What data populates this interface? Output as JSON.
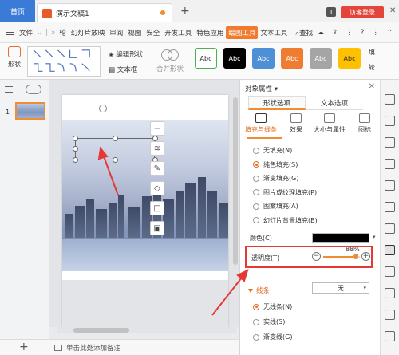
{
  "titlebar": {
    "home_tab": "首页",
    "doc_tab": "演示文稿1",
    "add_tab": "+",
    "badge": "1",
    "login": "访客登录",
    "close": "✕"
  },
  "menubar": {
    "file": "文件",
    "items": [
      "轮",
      "幻灯片放映",
      "审阅",
      "视图",
      "安全",
      "开发工具",
      "特色应用"
    ],
    "active": "绘图工具",
    "text_tool": "文本工具",
    "search": "查找",
    "right_icons": [
      "cloud-icon",
      "share-icon",
      "help-icon",
      "more-icon",
      "collapse-icon"
    ]
  },
  "ribbon": {
    "shape_label": "形状",
    "edit_shape": "编辑形状",
    "text_box": "文本框",
    "merge_shape": "合并形状",
    "style_label": "Abc",
    "styles": [
      {
        "bg": "#ffffff",
        "fg": "#333333",
        "border": "#4caf50"
      },
      {
        "bg": "#000000",
        "fg": "#ffffff",
        "border": "#000000"
      },
      {
        "bg": "#4f8fd6",
        "fg": "#ffffff",
        "border": "#4f8fd6"
      },
      {
        "bg": "#ee7d31",
        "fg": "#ffffff",
        "border": "#ee7d31"
      },
      {
        "bg": "#a5a5a5",
        "fg": "#ffffff",
        "border": "#a5a5a5"
      },
      {
        "bg": "#ffc000",
        "fg": "#333333",
        "border": "#ffc000"
      }
    ],
    "right_1": "填",
    "right_2": "轮"
  },
  "slides": {
    "current": "1"
  },
  "notes": {
    "placeholder": "单击此处添加备注"
  },
  "panel": {
    "title": "对象属性",
    "tab_shape": "形状选项",
    "tab_text": "文本选项",
    "subtabs": [
      "填充与线条",
      "效果",
      "大小与属性",
      "图标"
    ],
    "fill_options": [
      {
        "label": "无填充(N)",
        "checked": false
      },
      {
        "label": "纯色填充(S)",
        "checked": true
      },
      {
        "label": "渐变填充(G)",
        "checked": false
      },
      {
        "label": "图片或纹理填充(P)",
        "checked": false
      },
      {
        "label": "图案填充(A)",
        "checked": false
      },
      {
        "label": "幻灯片背景填充(B)",
        "checked": false
      }
    ],
    "color_label": "颜色(C)",
    "color_value": "#000000",
    "transparency_label": "透明度(T)",
    "transparency_value": "88%",
    "transparency_fraction": 0.88,
    "line_section": "线条",
    "line_select": "无",
    "line_options": [
      {
        "label": "无线条(N)",
        "checked": true
      },
      {
        "label": "实线(S)",
        "checked": false
      },
      {
        "label": "渐变线(G)",
        "checked": false
      }
    ]
  },
  "colors": {
    "accent": "#f08c33",
    "home_tab": "#3b7bd8",
    "highlight": "#e53935",
    "login": "#e4453a"
  }
}
